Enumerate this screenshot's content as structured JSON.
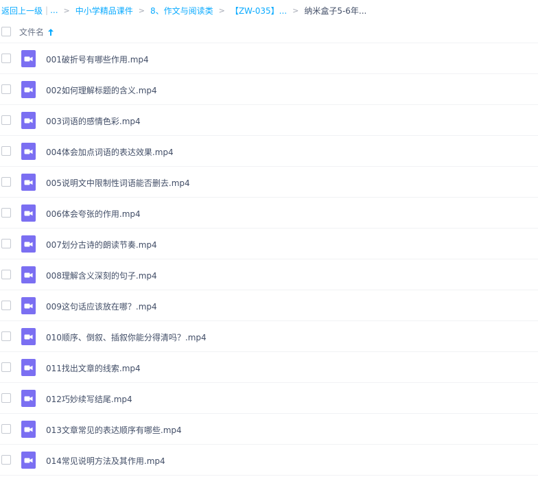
{
  "breadcrumb": {
    "back": "返回上一级",
    "ellipsis": "...",
    "items": [
      "中小学精品课件",
      "8、作文与阅读类",
      "【ZW-035】..."
    ],
    "current": "纳米盒子5-6年..."
  },
  "header": {
    "column_name": "文件名",
    "sort": "ascending"
  },
  "icon_color": "#7b6ff2",
  "files": [
    {
      "name": "001破折号有哪些作用.mp4",
      "icon": "video-file-icon"
    },
    {
      "name": "002如何理解标题的含义.mp4",
      "icon": "video-file-icon"
    },
    {
      "name": "003词语的感情色彩.mp4",
      "icon": "video-file-icon"
    },
    {
      "name": "004体会加点词语的表达效果.mp4",
      "icon": "video-file-icon"
    },
    {
      "name": "005说明文中限制性词语能否删去.mp4",
      "icon": "video-file-icon"
    },
    {
      "name": "006体会夸张的作用.mp4",
      "icon": "video-file-icon"
    },
    {
      "name": "007划分古诗的朗读节奏.mp4",
      "icon": "video-file-icon"
    },
    {
      "name": "008理解含义深刻的句子.mp4",
      "icon": "video-file-icon"
    },
    {
      "name": "009这句话应该放在哪？.mp4",
      "icon": "video-file-icon"
    },
    {
      "name": "010顺序、倒叙、插叙你能分得清吗？.mp4",
      "icon": "video-file-icon"
    },
    {
      "name": "011找出文章的线索.mp4",
      "icon": "video-file-icon"
    },
    {
      "name": "012巧妙续写结尾.mp4",
      "icon": "video-file-icon"
    },
    {
      "name": "013文章常见的表达顺序有哪些.mp4",
      "icon": "video-file-icon"
    },
    {
      "name": "014常见说明方法及其作用.mp4",
      "icon": "video-file-icon"
    }
  ]
}
